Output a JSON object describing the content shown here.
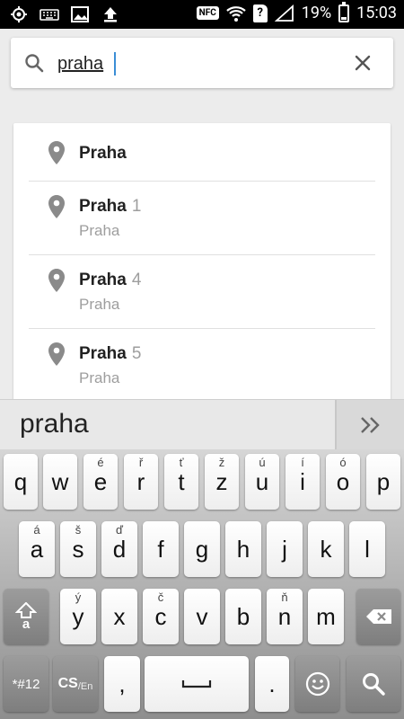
{
  "status_bar": {
    "nfc": "NFC",
    "sim": "?",
    "battery": "19%",
    "time": "15:03",
    "battery_fraction": 0.19
  },
  "search": {
    "value": "praha",
    "placeholder": ""
  },
  "results": [
    {
      "title": "Praha",
      "number": "",
      "subtitle": ""
    },
    {
      "title": "Praha",
      "number": "1",
      "subtitle": "Praha"
    },
    {
      "title": "Praha",
      "number": "4",
      "subtitle": "Praha"
    },
    {
      "title": "Praha",
      "number": "5",
      "subtitle": "Praha"
    }
  ],
  "suggestion": {
    "text": "praha"
  },
  "keyboard": {
    "row1": [
      {
        "label": "q",
        "alt": ""
      },
      {
        "label": "w",
        "alt": ""
      },
      {
        "label": "e",
        "alt": "é"
      },
      {
        "label": "r",
        "alt": "ř"
      },
      {
        "label": "t",
        "alt": "ť"
      },
      {
        "label": "z",
        "alt": "ž"
      },
      {
        "label": "u",
        "alt": "ú"
      },
      {
        "label": "i",
        "alt": "í"
      },
      {
        "label": "o",
        "alt": "ó"
      },
      {
        "label": "p",
        "alt": ""
      }
    ],
    "row2": [
      {
        "label": "a",
        "alt": "á"
      },
      {
        "label": "s",
        "alt": "š"
      },
      {
        "label": "d",
        "alt": "ď"
      },
      {
        "label": "f",
        "alt": ""
      },
      {
        "label": "g",
        "alt": ""
      },
      {
        "label": "h",
        "alt": ""
      },
      {
        "label": "j",
        "alt": ""
      },
      {
        "label": "k",
        "alt": ""
      },
      {
        "label": "l",
        "alt": ""
      }
    ],
    "row3": [
      {
        "label": "y",
        "alt": "ý"
      },
      {
        "label": "x",
        "alt": ""
      },
      {
        "label": "c",
        "alt": "č"
      },
      {
        "label": "v",
        "alt": ""
      },
      {
        "label": "b",
        "alt": ""
      },
      {
        "label": "n",
        "alt": "ň"
      },
      {
        "label": "m",
        "alt": ""
      }
    ],
    "shift_label": "a",
    "symbols_label": "*#12",
    "lang_label": "CS",
    "lang_sub": "/En",
    "comma": ",",
    "period": "."
  }
}
